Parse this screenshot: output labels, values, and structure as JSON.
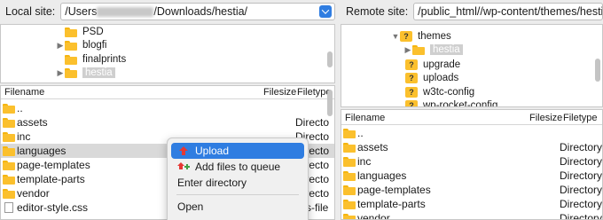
{
  "local": {
    "site_label": "Local site:",
    "path_prefix": "/Users",
    "path_suffix": "/Downloads/hestia/",
    "tree": [
      {
        "label": "PSD",
        "caret": ""
      },
      {
        "label": "blogfi",
        "caret": "▶"
      },
      {
        "label": "finalprints",
        "caret": ""
      },
      {
        "label": "hestia",
        "caret": "▶",
        "selected": true
      }
    ],
    "columns": {
      "name": "Filename",
      "size": "Filesize",
      "type": "Filetype"
    },
    "files": [
      {
        "name": "..",
        "type": ""
      },
      {
        "name": "assets",
        "type": "Directo"
      },
      {
        "name": "inc",
        "type": "Directo"
      },
      {
        "name": "languages",
        "type": "Directo"
      },
      {
        "name": "page-templates",
        "type": "Directo"
      },
      {
        "name": "template-parts",
        "type": "Directo"
      },
      {
        "name": "vendor",
        "type": "Directo"
      },
      {
        "name": "editor-style.css",
        "type": "css-file"
      }
    ]
  },
  "remote": {
    "site_label": "Remote site:",
    "path_prefix": "/public_html/",
    "path_suffix": "/wp-content/themes/hestia",
    "tree": [
      {
        "label": "themes",
        "caret": "▼"
      },
      {
        "label": "hestia",
        "caret": "▶",
        "selected": true
      },
      {
        "label": "upgrade",
        "caret": ""
      },
      {
        "label": "uploads",
        "caret": ""
      },
      {
        "label": "w3tc-config",
        "caret": ""
      },
      {
        "label": "wp-rocket-config",
        "caret": ""
      }
    ],
    "columns": {
      "name": "Filename",
      "size": "Filesize",
      "type": "Filetype"
    },
    "files": [
      {
        "name": "..",
        "type": ""
      },
      {
        "name": "assets",
        "type": "Directory"
      },
      {
        "name": "inc",
        "type": "Directory"
      },
      {
        "name": "languages",
        "type": "Directory"
      },
      {
        "name": "page-templates",
        "type": "Directory"
      },
      {
        "name": "template-parts",
        "type": "Directory"
      },
      {
        "name": "vendor",
        "type": "Directory"
      }
    ]
  },
  "context_menu": {
    "upload": "Upload",
    "add_queue": "Add files to queue",
    "enter_dir": "Enter directory",
    "open": "Open"
  },
  "colors": {
    "accent": "#2f7de1",
    "folder": "#fbc02d"
  }
}
